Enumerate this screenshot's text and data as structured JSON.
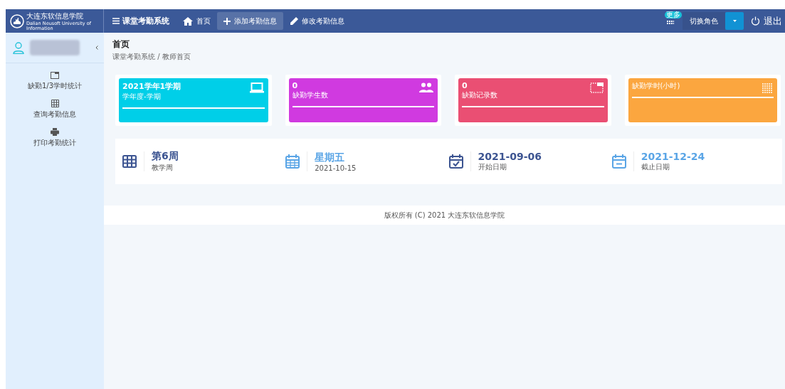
{
  "header": {
    "logo_name": "大连东软信息学院",
    "logo_subtitle": "Dalian Neusoft University of Information",
    "app_title": "课堂考勤系统",
    "nav": [
      {
        "label": "首页",
        "kind": "home",
        "selected": false
      },
      {
        "label": "添加考勤信息",
        "kind": "add",
        "selected": true
      },
      {
        "label": "修改考勤信息",
        "kind": "edit",
        "selected": false
      }
    ],
    "more_badge": "更多",
    "role_switch": {
      "label": "切换角色",
      "selected": true
    },
    "logout": "退出"
  },
  "sidebar": {
    "items": [
      {
        "label": "缺勤1/3学时统计",
        "kind": "window"
      },
      {
        "label": "查询考勤信息",
        "kind": "table"
      },
      {
        "label": "打印考勤统计",
        "kind": "print"
      }
    ]
  },
  "page": {
    "title": "首页",
    "breadcrumb": "课堂考勤系统 / 教师首页"
  },
  "stats": [
    {
      "value": "2021学年1学期",
      "label": "学年度-学期",
      "color": "#00cfe8",
      "kind": "laptop"
    },
    {
      "value": "0",
      "label": "缺勤学生数",
      "color": "#d03ae0",
      "kind": "people"
    },
    {
      "value": "0",
      "label": "缺勤记录数",
      "color": "#ea4f73",
      "kind": "window"
    },
    {
      "label": "缺勤学时(小时)",
      "color": "#fba63f",
      "kind": "dots"
    }
  ],
  "info": [
    {
      "value": "第6周",
      "label": "教学周",
      "color": "#3c5491",
      "kind": "table"
    },
    {
      "value": "星期五",
      "label": "2021-10-15",
      "color": "#5aa5e6",
      "kind": "calendar"
    },
    {
      "value": "2021-09-06",
      "label": "开始日期",
      "color": "#3c5491",
      "kind": "calendar-check"
    },
    {
      "value": "2021-12-24",
      "label": "截止日期",
      "color": "#5aa5e6",
      "kind": "calendar-minus"
    }
  ],
  "footer": "版权所有 (C) 2021 大连东软信息学院"
}
